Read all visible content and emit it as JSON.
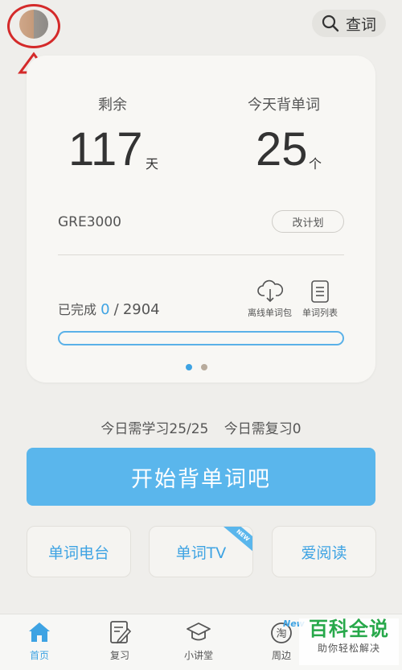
{
  "header": {
    "search_label": "查词"
  },
  "stats": {
    "remaining_label": "剩余",
    "remaining_value": "117",
    "remaining_unit": "天",
    "today_label": "今天背单词",
    "today_value": "25",
    "today_unit": "个"
  },
  "book": {
    "name": "GRE3000",
    "change_plan_label": "改计划"
  },
  "progress": {
    "completed_label": "已完成",
    "completed": "0",
    "separator": "/",
    "total": "2904",
    "fraction": 0
  },
  "tools": {
    "offline_label": "离线单词包",
    "list_label": "单词列表"
  },
  "today": {
    "learn_text": "今日需学习25/25",
    "review_text": "今日需复习0"
  },
  "start_button_label": "开始背单词吧",
  "features": [
    {
      "label": "单词电台"
    },
    {
      "label": "单词TV",
      "badge": "NEW"
    },
    {
      "label": "爱阅读"
    }
  ],
  "tabbar": {
    "items": [
      {
        "label": "首页",
        "icon": "home-icon"
      },
      {
        "label": "复习",
        "icon": "review-icon"
      },
      {
        "label": "小讲堂",
        "icon": "graduation-cap-icon"
      },
      {
        "label": "周边",
        "icon": "taobao-icon"
      }
    ],
    "new_badge": "New"
  },
  "watermark": {
    "title": "百科全说",
    "subtitle": "助你轻松解决"
  },
  "colors": {
    "accent": "#5ab6ec",
    "annotation": "#d42a2a",
    "watermark_green": "#27a84a"
  }
}
